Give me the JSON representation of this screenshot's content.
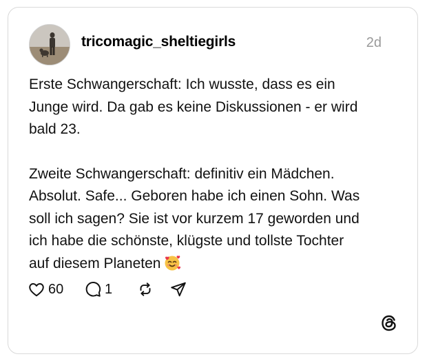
{
  "post": {
    "username": "tricomagic_sheltiegirls",
    "time": "2d",
    "paragraphs": [
      "Erste Schwangerschaft: Ich wusste, dass es ein\nJunge wird. Da gab es keine Diskussionen - er wird\nbald 23.",
      "Zweite Schwangerschaft: definitiv ein Mädchen.\nAbsolut. Safe... Geboren habe ich einen Sohn. Was\nsoll ich sagen? Sie ist vor kurzem 17 geworden und\nich habe die schönste, klügste und tollste Tochter\nauf diesem Planeten"
    ],
    "emoji": "smiling-face-with-hearts"
  },
  "actions": {
    "likes": "60",
    "replies": "1"
  },
  "icons": {
    "like": "heart-icon",
    "reply": "comment-icon",
    "repost": "repost-icon",
    "share": "send-icon",
    "brand": "threads-logo-icon"
  }
}
